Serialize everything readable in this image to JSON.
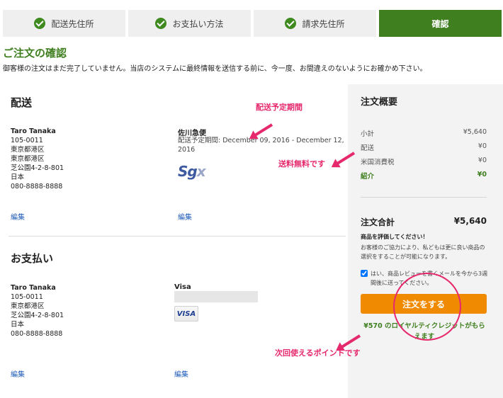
{
  "steps": {
    "shipping_address": "配送先住所",
    "payment_method": "お支払い方法",
    "billing_address": "請求先住所",
    "confirm": "確認"
  },
  "page": {
    "title": "ご注文の確認",
    "intro": "御客様の注文はまだ完了していません。当店のシステムに最終情報を送信する前に、今一度、お間違えのないようにお確かめ下さい。"
  },
  "shipping": {
    "section_title": "配送",
    "address": {
      "name": "Taro Tanaka",
      "postal": "105-0011",
      "line1": "東京都港区",
      "line2": "東京都港区",
      "line3": "芝公園4-2-8-801",
      "country": "日本",
      "phone": "080-8888-8888"
    },
    "edit_label": "編集",
    "carrier": {
      "name": "佐川急便",
      "eta_line1": "配送予定期間: December 09, 2016 - December 12,",
      "eta_line2": "2016",
      "logo_text": "Sg",
      "logo_x": "x"
    },
    "carrier_edit_label": "編集"
  },
  "payment": {
    "section_title": "お支払い",
    "address": {
      "name": "Taro Tanaka",
      "postal": "105-0011",
      "line1": "東京都港区",
      "line2": "芝公園4-2-8-801",
      "country": "日本",
      "phone": "080-8888-8888"
    },
    "edit_label": "編集",
    "card_brand": "Visa",
    "card_logo": "VISA",
    "card_edit_label": "編集"
  },
  "summary": {
    "title": "注文概要",
    "rows": [
      {
        "label": "小計",
        "value": "¥5,640"
      },
      {
        "label": "配送",
        "value": "¥0"
      },
      {
        "label": "米国消費税",
        "value": "¥0"
      },
      {
        "label": "紹介",
        "value": "¥0"
      }
    ],
    "total_label": "注文合計",
    "total_value": "¥5,640",
    "review_title": "商品を評価してください！",
    "review_text": "お客様のご協力により、私どもは更に良い商品の選択をすることが可能になります。",
    "review_checkbox": "はい、商品レビューを書くメールを今から3週間後に送ってください。",
    "order_button": "注文をする",
    "loyalty_text": "¥570 のロイヤルティクレジットがもらえます"
  },
  "annotations": {
    "delivery_period": "配送予定期間",
    "free_shipping": "送料無料です",
    "points_next_time": "次回使えるポイントです"
  },
  "colors": {
    "brand_green": "#3f7f1f",
    "button_orange": "#f08a00",
    "annotation_pink": "#e6286d",
    "link_blue": "#1e5bb8"
  }
}
